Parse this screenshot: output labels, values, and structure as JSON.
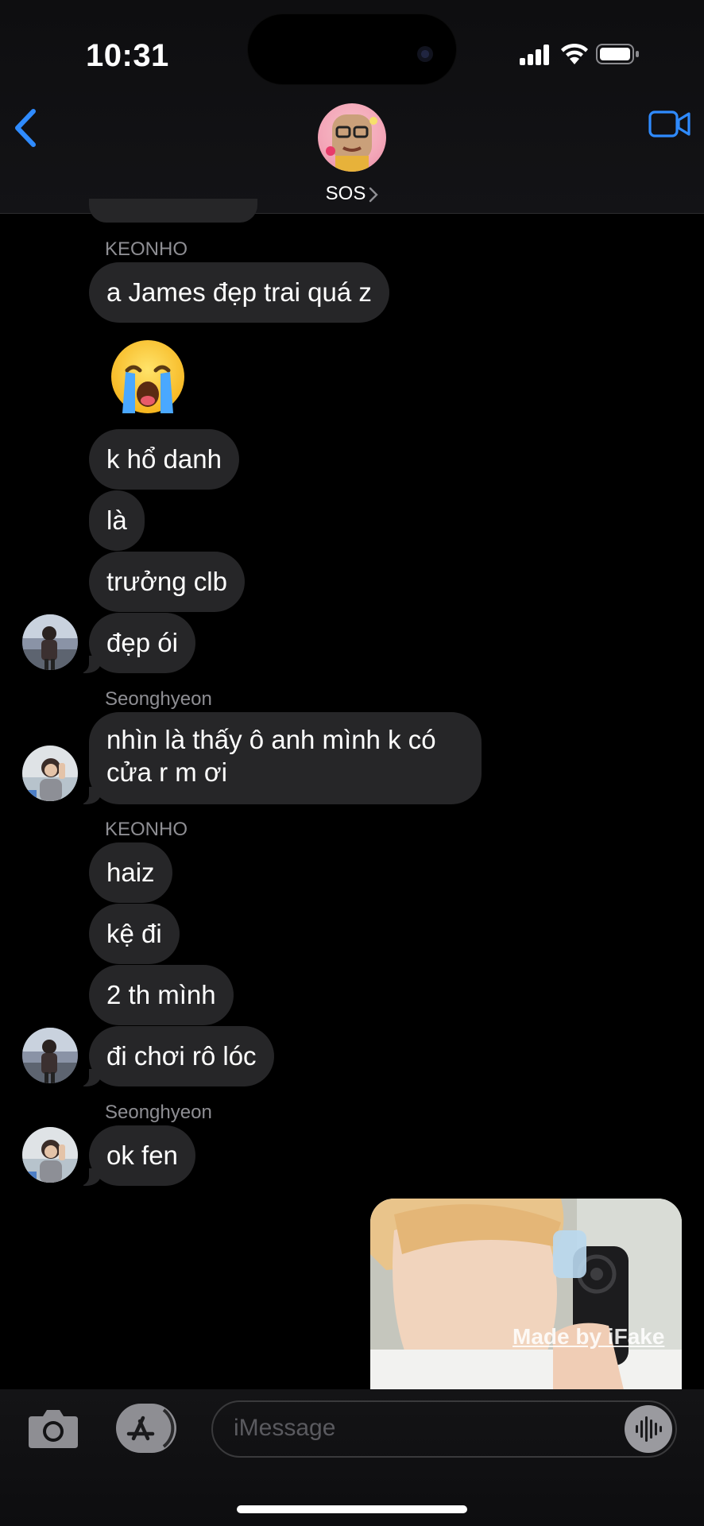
{
  "status": {
    "time": "10:31"
  },
  "header": {
    "title": "SOS",
    "icons": {
      "back": "chevron-left-icon",
      "video": "video-camera-icon",
      "title_chevron": "chevron-right-icon"
    }
  },
  "colors": {
    "accent": "#2f8bff",
    "bubble_incoming": "#262628",
    "sender_label": "#8e8e93",
    "background": "#000000"
  },
  "messages": [
    {
      "sender": "KEONHO",
      "text": "a James đẹp trai quá z"
    },
    {
      "sender": "KEONHO",
      "emoji": "loudly-crying-face"
    },
    {
      "sender": "KEONHO",
      "text": "k hổ danh"
    },
    {
      "sender": "KEONHO",
      "text": "là"
    },
    {
      "sender": "KEONHO",
      "text": "trưởng clb"
    },
    {
      "sender": "KEONHO",
      "text": "đẹp ói"
    },
    {
      "sender": "Seonghyeon",
      "text_line1": "nhìn là thấy ô anh mình k có",
      "text_line2": "cửa r m ơi"
    },
    {
      "sender": "KEONHO",
      "text": "haiz"
    },
    {
      "sender": "KEONHO",
      "text": "kệ đi"
    },
    {
      "sender": "KEONHO",
      "text": "2 th mình"
    },
    {
      "sender": "KEONHO",
      "text": "đi chơi rô lóc"
    },
    {
      "sender": "Seonghyeon",
      "text": "ok fen"
    }
  ],
  "photo_message": {
    "watermark": "Made by iFake"
  },
  "composer": {
    "placeholder": "iMessage",
    "icons": {
      "camera": "camera-icon",
      "apps": "app-store-icon",
      "audio": "waveform-icon"
    }
  }
}
